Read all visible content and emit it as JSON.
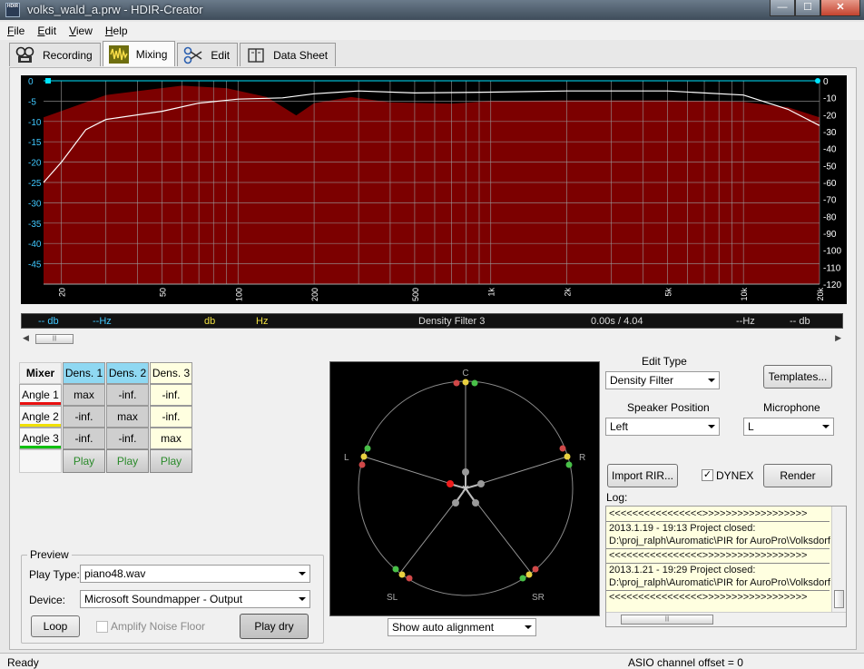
{
  "window": {
    "icon_text": "HDIR",
    "title": "volks_wald_a.prw - HDIR-Creator",
    "min_glyph": "—",
    "max_glyph": "☐",
    "close_glyph": "✕"
  },
  "menu": [
    "File",
    "Edit",
    "View",
    "Help"
  ],
  "tabs": [
    {
      "label": "Recording",
      "icon": "microphone-recorder-icon",
      "active": false
    },
    {
      "label": "Mixing",
      "icon": "mixing-waveform-icon",
      "active": true
    },
    {
      "label": "Edit",
      "icon": "scissors-icon",
      "active": false
    },
    {
      "label": "Data Sheet",
      "icon": "book-icon",
      "active": false
    }
  ],
  "readout": {
    "left_db": "-- db",
    "left_hz": "--Hz",
    "cursor_db": "db",
    "cursor_hz": "Hz",
    "filter_name": "Density Filter 3",
    "time": "0.00s / 4.04",
    "right_hz": "--Hz",
    "right_db": "-- db"
  },
  "chart_data": {
    "type": "area",
    "x_scale": "log",
    "xlim": [
      17,
      20000
    ],
    "left_ylim": [
      -50,
      0
    ],
    "right_ylim": [
      -120,
      0
    ],
    "grid": true,
    "x_ticks": [
      20,
      50,
      100,
      200,
      500,
      "1k",
      "2k",
      "5k",
      "10k",
      "20k"
    ],
    "left_ticks": [
      0,
      -5,
      -10,
      -15,
      -20,
      -25,
      -30,
      -35,
      -40,
      -45
    ],
    "right_ticks": [
      0,
      -10,
      -20,
      -30,
      -40,
      -50,
      -60,
      -70,
      -80,
      -90,
      -100,
      -110,
      -120
    ],
    "series": [
      {
        "style": "filled area",
        "color": "#7c0000",
        "axis": "left",
        "x": [
          17,
          30,
          60,
          90,
          130,
          170,
          200,
          280,
          400,
          700,
          1000,
          2000,
          5000,
          10000,
          15000,
          20000
        ],
        "y": [
          -9,
          -3.5,
          -1.2,
          -1.8,
          -4,
          -8.5,
          -5.5,
          -4,
          -5.3,
          -5.6,
          -5,
          -4.8,
          -4.8,
          -5.2,
          -6.5,
          -9
        ]
      },
      {
        "style": "line",
        "color": "#ffffff",
        "axis": "left",
        "x": [
          17,
          20,
          25,
          30,
          50,
          70,
          100,
          150,
          200,
          300,
          500,
          1000,
          2000,
          5000,
          10000,
          15000,
          20000
        ],
        "y": [
          -25,
          -20,
          -12,
          -9.5,
          -7.5,
          -5.5,
          -4.5,
          -4.2,
          -3.2,
          -2.5,
          -3,
          -2.8,
          -2.5,
          -2.5,
          -3.5,
          -7,
          -11
        ]
      }
    ]
  },
  "mixer": {
    "corner": "Mixer",
    "dens_headers": [
      "Dens. 1",
      "Dens. 2",
      "Dens. 3"
    ],
    "rows": [
      {
        "label": "Angle 1",
        "values": [
          "max",
          "-inf.",
          "-inf."
        ]
      },
      {
        "label": "Angle 2",
        "values": [
          "-inf.",
          "max",
          "-inf."
        ]
      },
      {
        "label": "Angle 3",
        "values": [
          "-inf.",
          "-inf.",
          "max"
        ]
      }
    ],
    "play": [
      "Play",
      "Play",
      "Play"
    ]
  },
  "preview": {
    "legend": "Preview",
    "play_type_label": "Play Type:",
    "play_type_value": "piano48.wav",
    "device_label": "Device:",
    "device_value": "Microsoft Soundmapper - Output",
    "loop": "Loop",
    "amplify": "Amplify Noise Floor",
    "play_dry": "Play dry"
  },
  "speakers": {
    "labels": {
      "c": "C",
      "l": "L",
      "r": "R",
      "sl": "SL",
      "sr": "SR"
    },
    "alignment_select": "Show auto alignment"
  },
  "controls": {
    "edit_type_label": "Edit Type",
    "edit_type_value": "Density Filter",
    "templates": "Templates...",
    "speaker_pos_label": "Speaker Position",
    "speaker_pos_value": "Left",
    "microphone_label": "Microphone",
    "microphone_value": "L",
    "import_rir": "Import RIR...",
    "dynex": "DYNEX",
    "dynex_checked": true,
    "render": "Render"
  },
  "log": {
    "label": "Log:",
    "lines": [
      "<<<<<<<<<<<<<<<<>>>>>>>>>>>>>>>>>>",
      "2013.1.19 - 19:13  Project closed:",
      "D:\\proj_ralph\\Auromatic\\PIR for AuroPro\\Volksdorf",
      "<<<<<<<<<<<<<<<<>>>>>>>>>>>>>>>>>>",
      "2013.1.21 - 19:29  Project closed:",
      "D:\\proj_ralph\\Auromatic\\PIR for AuroPro\\Volksdorf",
      "<<<<<<<<<<<<<<<<>>>>>>>>>>>>>>>>>>"
    ]
  },
  "status": {
    "left": "Ready",
    "right": "ASIO channel offset = 0"
  },
  "colors": {
    "area_fill": "#7c0000",
    "line": "#ffffff",
    "left_axis": "#40c8ff",
    "cursor_marker": "#00e5ff",
    "density_header": "#8fd8f2",
    "log_background": "#ffffe0"
  }
}
